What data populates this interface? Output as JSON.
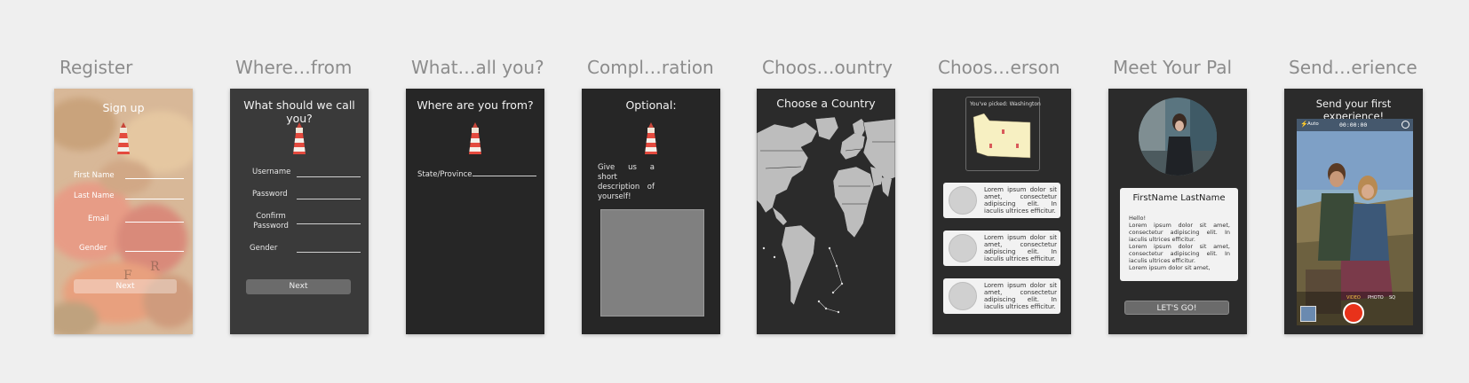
{
  "artboards": [
    {
      "title": "Register"
    },
    {
      "title": "Where…from"
    },
    {
      "title": "What…all you?"
    },
    {
      "title": "Compl…ration"
    },
    {
      "title": "Choos…ountry"
    },
    {
      "title": "Choos…erson"
    },
    {
      "title": "Meet Your Pal"
    },
    {
      "title": "Send…erience"
    }
  ],
  "register": {
    "heading": "Sign up",
    "first_name": "First Name",
    "last_name": "Last Name",
    "email": "Email",
    "gender": "Gender",
    "next": "Next"
  },
  "call_you": {
    "heading": "What should we call you?",
    "username": "Username",
    "password": "Password",
    "confirm": "Confirm Password",
    "gender": "Gender",
    "next": "Next"
  },
  "where_from": {
    "heading": "Where are you from?",
    "state": "State/Province"
  },
  "optional": {
    "heading": "Optional:",
    "prompt": "Give us a short description of yourself!"
  },
  "country": {
    "heading": "Choose a Country"
  },
  "person": {
    "picked": "You've picked: Washington",
    "cards": [
      {
        "text": "Lorem ipsum dolor sit amet, consectetur adipiscing elit. In iaculis ultrices efficitur."
      },
      {
        "text": "Lorem ipsum dolor sit amet, consectetur adipiscing elit. In iaculis ultrices efficitur."
      },
      {
        "text": "Lorem ipsum dolor sit amet, consectetur adipiscing elit. In iaculis ultrices efficitur."
      }
    ]
  },
  "pal": {
    "name": "FirstName LastName",
    "bio": "Hello!\nLorem ipsum dolor sit amet, consectetur adipiscing elit. In iaculis ultrices efficitur.\nLorem ipsum dolor sit amet, consectetur adipiscing elit. In iaculis ultrices efficitur.\nLorem ipsum dolor sit amet,",
    "button": "LET'S GO!"
  },
  "experience": {
    "heading": "Send your first experience!",
    "flash": "Auto",
    "timer": "00:00:00",
    "modes": [
      "VIDEO",
      "PHOTO",
      "SQ"
    ]
  },
  "colors": {
    "accent_record": "#e8321a",
    "screen_dark": "#262626",
    "screen_mid": "#3a3a3a",
    "map_land": "#bdbdbd",
    "washington": "#f7f0c2"
  }
}
